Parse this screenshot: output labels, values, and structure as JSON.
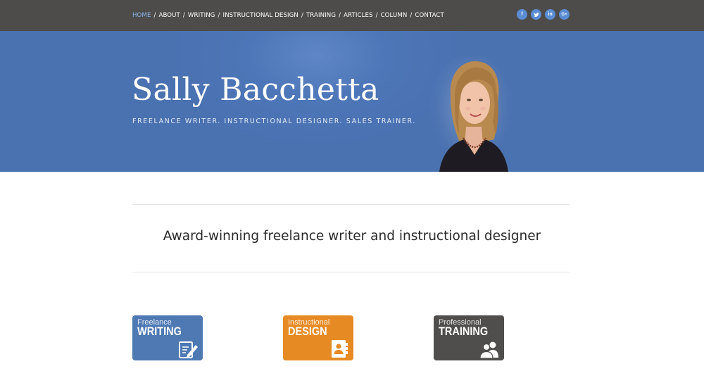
{
  "nav": {
    "items": [
      {
        "label": "HOME",
        "active": true
      },
      {
        "label": "ABOUT",
        "active": false
      },
      {
        "label": "WRITING",
        "active": false
      },
      {
        "label": "INSTRUCTIONAL DESIGN",
        "active": false
      },
      {
        "label": "TRAINING",
        "active": false
      },
      {
        "label": "ARTICLES",
        "active": false
      },
      {
        "label": "COLUMN",
        "active": false
      },
      {
        "label": "CONTACT",
        "active": false
      }
    ],
    "separator": "/"
  },
  "social": {
    "icons": [
      {
        "name": "facebook-icon",
        "glyph": "f"
      },
      {
        "name": "twitter-icon",
        "glyph": "t"
      },
      {
        "name": "linkedin-icon",
        "glyph": "in"
      },
      {
        "name": "google-plus-icon",
        "glyph": "G+"
      }
    ],
    "color": "#5b8dd4"
  },
  "hero": {
    "name": "Sally Bacchetta",
    "tagline": "FREELANCE WRITER. INSTRUCTIONAL DESIGNER. SALES TRAINER.",
    "background": "#4a71b0"
  },
  "main": {
    "headline": "Award-winning freelance writer and instructional designer"
  },
  "tiles": [
    {
      "small": "Freelance",
      "big": "WRITING",
      "color": "#4e79b3",
      "icon": "document-pen-icon"
    },
    {
      "small": "Instructional",
      "big": "DESIGN",
      "color": "#e68a24",
      "icon": "address-book-icon"
    },
    {
      "small": "Professional",
      "big": "TRAINING",
      "color": "#4f4e4c",
      "icon": "people-icon"
    }
  ]
}
